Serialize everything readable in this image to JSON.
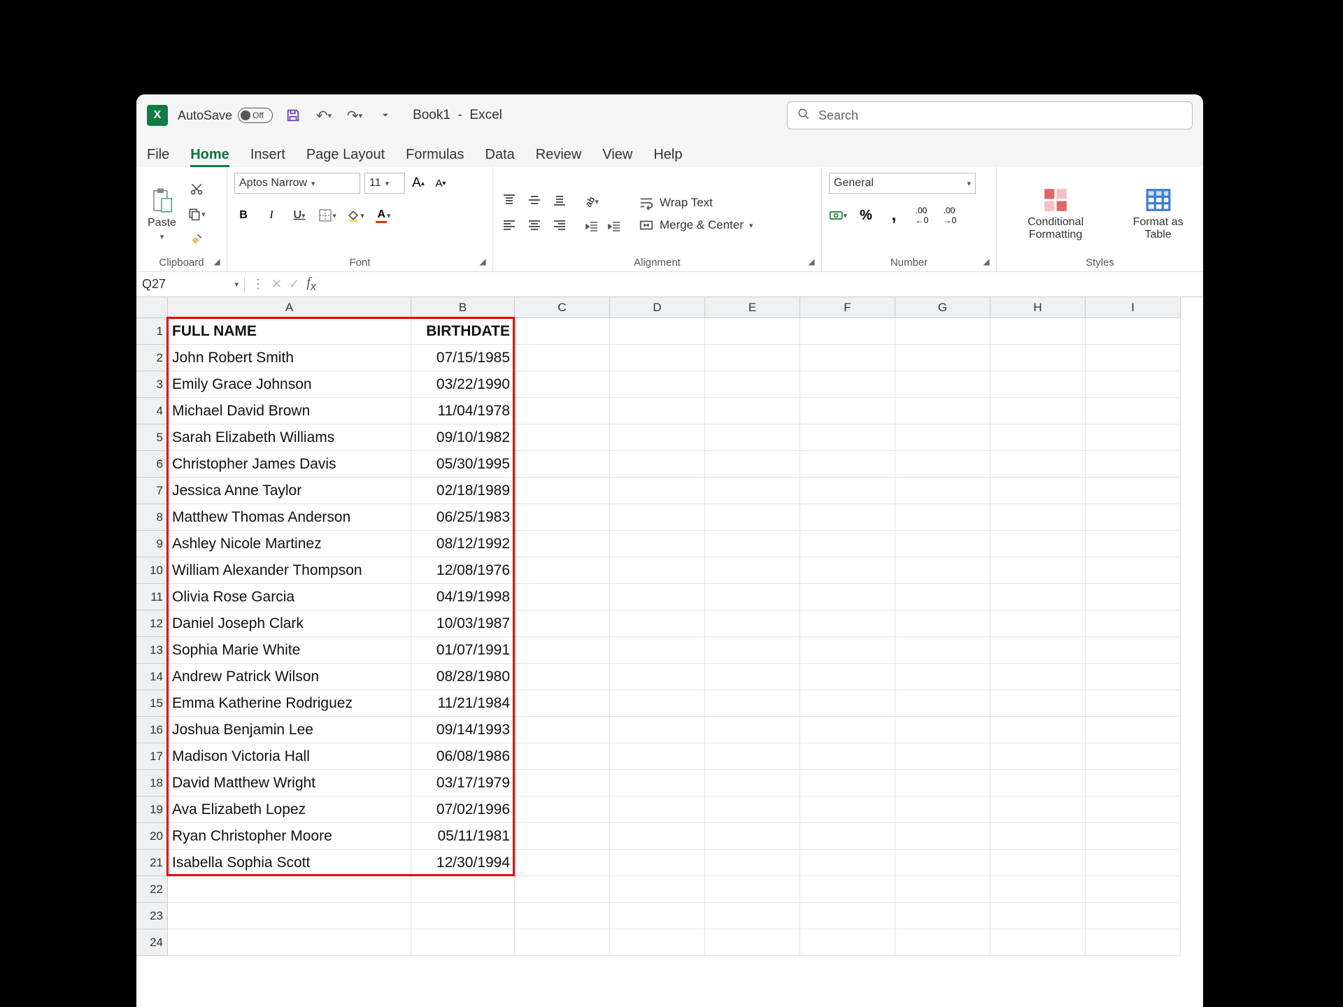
{
  "titlebar": {
    "autosave_label": "AutoSave",
    "autosave_state": "Off",
    "doc_name": "Book1",
    "app_name": "Excel",
    "search_placeholder": "Search"
  },
  "tabs": [
    "File",
    "Home",
    "Insert",
    "Page Layout",
    "Formulas",
    "Data",
    "Review",
    "View",
    "Help"
  ],
  "active_tab": "Home",
  "ribbon": {
    "clipboard": {
      "paste": "Paste",
      "label": "Clipboard"
    },
    "font": {
      "name": "Aptos Narrow",
      "size": "11",
      "label": "Font"
    },
    "alignment": {
      "wrap": "Wrap Text",
      "merge": "Merge & Center",
      "label": "Alignment"
    },
    "number": {
      "format": "General",
      "label": "Number"
    },
    "styles": {
      "cond": "Conditional Formatting",
      "fmt_table": "Format as Table",
      "label": "Styles"
    }
  },
  "namebox": "Q27",
  "columns": [
    "A",
    "B",
    "C",
    "D",
    "E",
    "F",
    "G",
    "H",
    "I"
  ],
  "headers": {
    "full_name": "FULL NAME",
    "birthdate": "BIRTHDATE"
  },
  "rows": [
    {
      "full_name": "John Robert Smith",
      "birthdate": "07/15/1985"
    },
    {
      "full_name": "Emily Grace Johnson",
      "birthdate": "03/22/1990"
    },
    {
      "full_name": "Michael David Brown",
      "birthdate": "11/04/1978"
    },
    {
      "full_name": "Sarah Elizabeth Williams",
      "birthdate": "09/10/1982"
    },
    {
      "full_name": "Christopher James Davis",
      "birthdate": "05/30/1995"
    },
    {
      "full_name": "Jessica Anne Taylor",
      "birthdate": "02/18/1989"
    },
    {
      "full_name": "Matthew Thomas Anderson",
      "birthdate": "06/25/1983"
    },
    {
      "full_name": "Ashley Nicole Martinez",
      "birthdate": "08/12/1992"
    },
    {
      "full_name": "William Alexander Thompson",
      "birthdate": "12/08/1976"
    },
    {
      "full_name": "Olivia Rose Garcia",
      "birthdate": "04/19/1998"
    },
    {
      "full_name": "Daniel Joseph Clark",
      "birthdate": "10/03/1987"
    },
    {
      "full_name": "Sophia Marie White",
      "birthdate": "01/07/1991"
    },
    {
      "full_name": "Andrew Patrick Wilson",
      "birthdate": "08/28/1980"
    },
    {
      "full_name": "Emma Katherine Rodriguez",
      "birthdate": "11/21/1984"
    },
    {
      "full_name": "Joshua Benjamin Lee",
      "birthdate": "09/14/1993"
    },
    {
      "full_name": "Madison Victoria Hall",
      "birthdate": "06/08/1986"
    },
    {
      "full_name": "David Matthew Wright",
      "birthdate": "03/17/1979"
    },
    {
      "full_name": "Ava Elizabeth Lopez",
      "birthdate": "07/02/1996"
    },
    {
      "full_name": "Ryan Christopher Moore",
      "birthdate": "05/11/1981"
    },
    {
      "full_name": "Isabella Sophia Scott",
      "birthdate": "12/30/1994"
    }
  ],
  "highlight_range": "A1:B21",
  "chart_data": {
    "type": "table",
    "title": "",
    "columns": [
      "FULL NAME",
      "BIRTHDATE"
    ],
    "rows": [
      [
        "John Robert Smith",
        "07/15/1985"
      ],
      [
        "Emily Grace Johnson",
        "03/22/1990"
      ],
      [
        "Michael David Brown",
        "11/04/1978"
      ],
      [
        "Sarah Elizabeth Williams",
        "09/10/1982"
      ],
      [
        "Christopher James Davis",
        "05/30/1995"
      ],
      [
        "Jessica Anne Taylor",
        "02/18/1989"
      ],
      [
        "Matthew Thomas Anderson",
        "06/25/1983"
      ],
      [
        "Ashley Nicole Martinez",
        "08/12/1992"
      ],
      [
        "William Alexander Thompson",
        "12/08/1976"
      ],
      [
        "Olivia Rose Garcia",
        "04/19/1998"
      ],
      [
        "Daniel Joseph Clark",
        "10/03/1987"
      ],
      [
        "Sophia Marie White",
        "01/07/1991"
      ],
      [
        "Andrew Patrick Wilson",
        "08/28/1980"
      ],
      [
        "Emma Katherine Rodriguez",
        "11/21/1984"
      ],
      [
        "Joshua Benjamin Lee",
        "09/14/1993"
      ],
      [
        "Madison Victoria Hall",
        "06/08/1986"
      ],
      [
        "David Matthew Wright",
        "03/17/1979"
      ],
      [
        "Ava Elizabeth Lopez",
        "07/02/1996"
      ],
      [
        "Ryan Christopher Moore",
        "05/11/1981"
      ],
      [
        "Isabella Sophia Scott",
        "12/30/1994"
      ]
    ]
  }
}
